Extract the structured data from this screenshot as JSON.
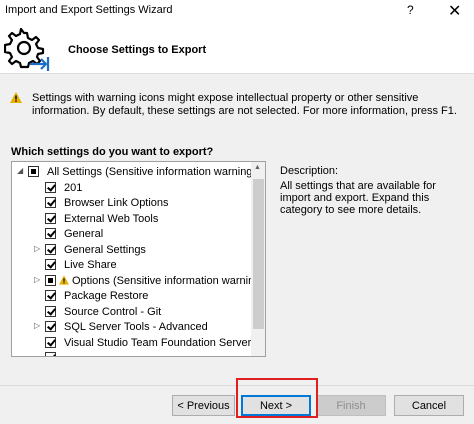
{
  "window": {
    "title": "Import and Export Settings Wizard",
    "help_glyph": "?",
    "close_glyph": "✕"
  },
  "header": {
    "title": "Choose Settings to Export"
  },
  "warning": {
    "text": "Settings with warning icons might expose intellectual property or other sensitive information. By default, these settings are not selected. For more information, press F1."
  },
  "question": "Which settings do you want to export?",
  "tree": {
    "items": [
      {
        "label": "All Settings (Sensitive information warning)",
        "state": "partial",
        "expander": "open",
        "level": 0,
        "warning": false
      },
      {
        "label": "201",
        "state": "checked",
        "expander": "none",
        "level": 1,
        "warning": false
      },
      {
        "label": "Browser Link Options",
        "state": "checked",
        "expander": "none",
        "level": 1,
        "warning": false
      },
      {
        "label": "External Web Tools",
        "state": "checked",
        "expander": "none",
        "level": 1,
        "warning": false
      },
      {
        "label": "General",
        "state": "checked",
        "expander": "none",
        "level": 1,
        "warning": false
      },
      {
        "label": "General Settings",
        "state": "checked",
        "expander": "closed",
        "level": 1,
        "warning": false
      },
      {
        "label": "Live Share",
        "state": "checked",
        "expander": "none",
        "level": 1,
        "warning": false
      },
      {
        "label": "Options (Sensitive information warning)",
        "state": "partial",
        "expander": "closed",
        "level": 1,
        "warning": true
      },
      {
        "label": "Package Restore",
        "state": "checked",
        "expander": "none",
        "level": 1,
        "warning": false
      },
      {
        "label": "Source Control - Git",
        "state": "checked",
        "expander": "none",
        "level": 1,
        "warning": false
      },
      {
        "label": "SQL Server Tools - Advanced",
        "state": "checked",
        "expander": "closed",
        "level": 1,
        "warning": false
      },
      {
        "label": "Visual Studio Team Foundation Server",
        "state": "checked",
        "expander": "none",
        "level": 1,
        "warning": false
      },
      {
        "label": "",
        "state": "checked",
        "expander": "none",
        "level": 1,
        "warning": false
      }
    ]
  },
  "description": {
    "label": "Description:",
    "text": "All settings that are available for import and export. Expand this category to see more details."
  },
  "buttons": {
    "previous": "< Previous",
    "next": "Next >",
    "finish": "Finish",
    "cancel": "Cancel"
  },
  "colors": {
    "accent": "#0078d7",
    "highlight": "#e02020",
    "warning": "#e8b000",
    "logo_arrow": "#1a6fc9"
  },
  "icons": {
    "logo": "settings-gear-export-icon",
    "warning": "warning-triangle-icon"
  }
}
